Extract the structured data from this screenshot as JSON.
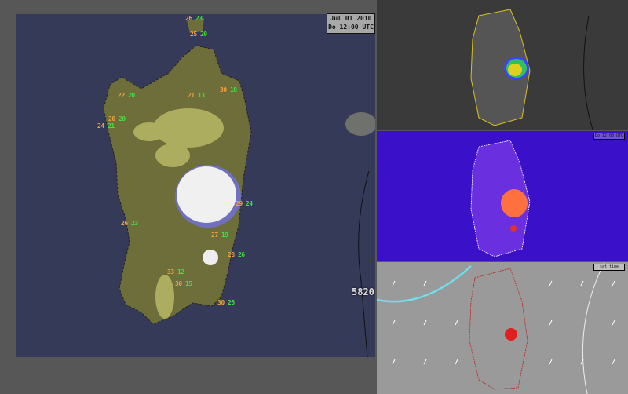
{
  "main_map": {
    "date": "Jul 01 2010",
    "time": "Do 12:00 UTC",
    "contour_value": "5820",
    "stations": [
      {
        "temp": "26",
        "dew": "23"
      },
      {
        "temp": "25",
        "dew": "20"
      },
      {
        "temp": "22",
        "dew": "20"
      },
      {
        "temp": "21",
        "dew": "13"
      },
      {
        "temp": "30",
        "dew": "18"
      },
      {
        "temp": "20",
        "dew": "20"
      },
      {
        "temp": "24",
        "dew": "21"
      },
      {
        "temp": "29",
        "dew": "24"
      },
      {
        "temp": "26",
        "dew": "23"
      },
      {
        "temp": "27",
        "dew": "19"
      },
      {
        "temp": "28",
        "dew": "26"
      },
      {
        "temp": "33",
        "dew": "12"
      },
      {
        "temp": "30",
        "dew": "15"
      },
      {
        "temp": "30",
        "dew": "26"
      }
    ]
  },
  "panels": {
    "cape": {
      "label": "Do 12:00 UTC"
    },
    "wind": {
      "label": "sat-time"
    }
  },
  "colors": {
    "sea": "#353a58",
    "land": "#6e6e3a",
    "cloud": "#f0f0f0",
    "cape_bg": "#3a10c8"
  }
}
